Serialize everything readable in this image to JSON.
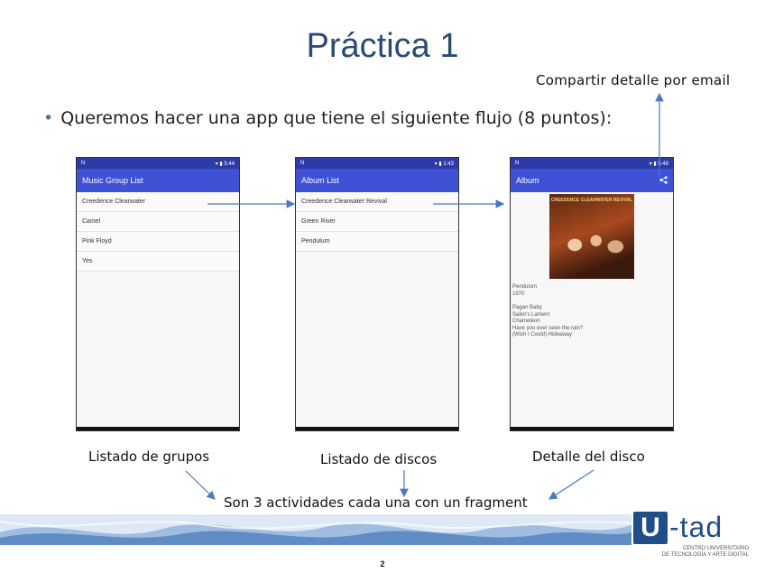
{
  "slide": {
    "title": "Práctica 1",
    "share_note": "Compartir detalle por email",
    "bullet": "Queremos hacer una app que tiene el siguiente flujo (8 puntos):",
    "bottom_note": "Son 3 actividades cada una con un fragment",
    "page_number": "2"
  },
  "phones": {
    "groups": {
      "time": "5:44",
      "title": "Music Group List",
      "items": [
        "Creedence Clearwater",
        "Camel",
        "Pink Floyd",
        "Yes"
      ],
      "caption": "Listado de grupos"
    },
    "albums": {
      "time": "1:43",
      "title": "Album List",
      "items": [
        "Creedence Clearwater Revival",
        "Green River",
        "Pendulum"
      ],
      "caption": "Listado de discos"
    },
    "detail": {
      "time": "5:48",
      "title": "Album",
      "cover_text": "CREEDENCE CLEARWATER REVIVAL",
      "album_name": "Pendulum",
      "year": "1970",
      "tracks": [
        "Pagan Baby",
        "Sailor's Lament",
        "Chameleon",
        "Have you ever seen the rain?",
        "(Wish I Could) Hideaway"
      ],
      "caption": "Detalle del disco"
    }
  },
  "logo": {
    "u": "U",
    "tad": "-tad",
    "line1": "CENTRO UNIVERSITARIO",
    "line2": "DE TECNOLOGÍA Y ARTE DIGITAL"
  },
  "colors": {
    "title": "#2b4a74",
    "status_bar": "#2e3aa6",
    "app_bar": "#3f51d4",
    "arrow": "#4a78c4",
    "brand": "#1f4e8a"
  }
}
